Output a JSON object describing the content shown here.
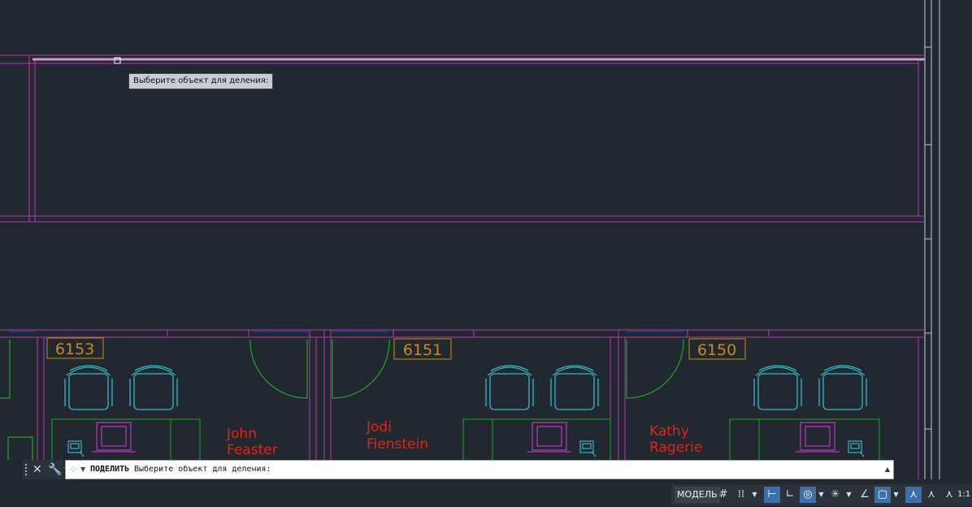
{
  "tooltip": {
    "text": "Выберите объект для деления:"
  },
  "command_line": {
    "command": "ПОДЕЛИТЬ",
    "prompt": "Выберите объект для деления:"
  },
  "rooms": [
    {
      "number": "6153",
      "occupant_first": "John",
      "occupant_last": "Feaster"
    },
    {
      "number": "6151",
      "occupant_first": "Jodi",
      "occupant_last": "Fienstein"
    },
    {
      "number": "6150",
      "occupant_first": "Kathy",
      "occupant_last": "Ragerie"
    }
  ],
  "status_bar": {
    "model_label": "МОДЕЛЬ",
    "scale": "1:1",
    "icons": [
      "grid-icon",
      "snap-icon",
      "infer-constraints-icon",
      "ortho-icon",
      "polar-icon",
      "osnap-tracking-icon",
      "isodraft-icon",
      "annotation-visibility-icon",
      "autoscale-icon",
      "annotation-scale-icon"
    ]
  },
  "colors": {
    "background": "#212830",
    "wall": "#b636b8",
    "door": "#1fa62b",
    "furniture": "#35b8c8",
    "room_tag": "#c98a16",
    "occupant_text": "#e2231a",
    "window_blue": "#2a3ea8"
  }
}
